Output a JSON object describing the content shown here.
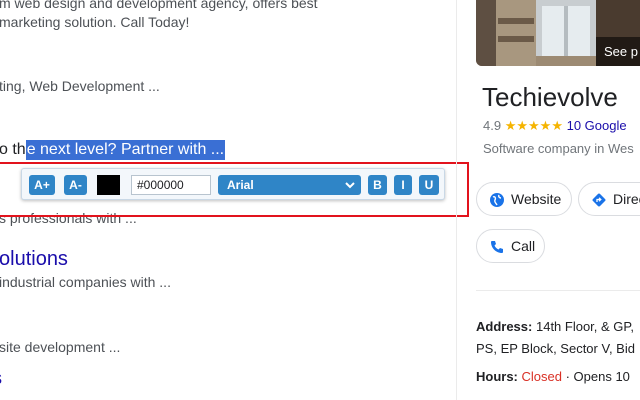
{
  "results": {
    "line1": "m web design and development agency, offers best",
    "line2": "marketing solution. Call Today!",
    "line3": "ting, Web Development ...",
    "highlight_pre": "o th",
    "highlight_sel": "e next level? Partner with ...",
    "line5": "s professionals with ...",
    "title2": "olutions",
    "line6": "industrial companies with ...",
    "line7": "site development ...",
    "arrow": "s"
  },
  "toolbar": {
    "increase_label": "A+",
    "decrease_label": "A-",
    "color_value": "#000000",
    "color_swatch": "#000000",
    "font_value": "Arial",
    "bold_label": "B",
    "italic_label": "I",
    "underline_label": "U"
  },
  "knowledge_panel": {
    "photo_label": "See p",
    "title": "Techievolve",
    "rating": "4.9",
    "stars": "★★★★★",
    "reviews": "10 Google",
    "category": "Software company in Wes",
    "website_label": "Website",
    "directions_label": "Direc",
    "call_label": "Call",
    "address_label": "Address:",
    "address_line1": "14th Floor, & GP,",
    "address_line2": "PS, EP Block, Sector V, Bid",
    "hours_label": "Hours:",
    "hours_status": "Closed",
    "hours_rest": " · Opens 10"
  },
  "colors": {
    "accent": "#2f85c7",
    "selection": "#3a6fd4",
    "link": "#1a0dab",
    "annotation_red": "#e2131d",
    "closed_red": "#d93025"
  }
}
